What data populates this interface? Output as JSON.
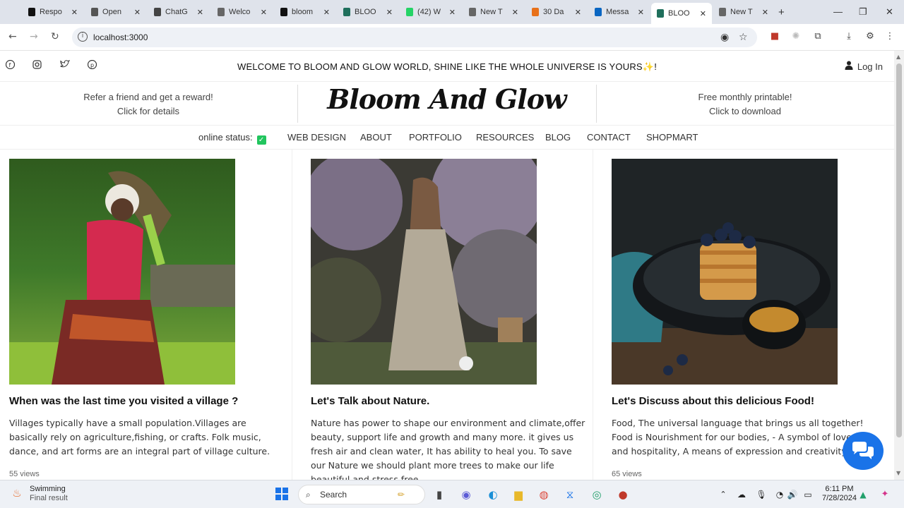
{
  "browser": {
    "tabs": [
      {
        "label": "Respo",
        "favicon_color": "#111111"
      },
      {
        "label": "Open",
        "favicon_color": "#555555"
      },
      {
        "label": "ChatG",
        "favicon_color": "#444444"
      },
      {
        "label": "Welco",
        "favicon_color": "#666666"
      },
      {
        "label": "bloom",
        "favicon_color": "#111111"
      },
      {
        "label": "BLOO",
        "favicon_color": "#1f6f5c"
      },
      {
        "label": "(42) W",
        "favicon_color": "#25d366"
      },
      {
        "label": "New T",
        "favicon_color": "#666666"
      },
      {
        "label": "30 Da",
        "favicon_color": "#e8711a"
      },
      {
        "label": "Messa",
        "favicon_color": "#0a66c2"
      },
      {
        "label": "BLOO",
        "favicon_color": "#1f6f5c",
        "active": true
      },
      {
        "label": "New T",
        "favicon_color": "#666666"
      }
    ],
    "url": "localhost:3000"
  },
  "site": {
    "welcome": "WELCOME TO BLOOM AND GLOW WORLD, SHINE LIKE THE WHOLE UNIVERSE IS YOURS",
    "welcome_emoji": "✨",
    "welcome_end": "!",
    "login_label": "Log In",
    "promo_left": {
      "line1": "Refer a friend and get a reward!",
      "line2": "Click for details"
    },
    "logo": "Bloom And Glow",
    "promo_right": {
      "line1": "Free monthly printable!",
      "line2": "Click to download"
    },
    "nav": {
      "status_label": "online status:",
      "items": [
        "WEB DESIGN",
        "ABOUT",
        "PORTFOLIO",
        "RESOURCES",
        "BLOG",
        "CONTACT",
        "SHOPMART"
      ]
    },
    "cards": [
      {
        "title": "When was the last time you visited a village ?",
        "text": "Villages typically have a small population.Villages are basically rely on agriculture,fishing, or crafts. Folk music, dance, and art forms are an integral part of village culture.",
        "views": "55 views"
      },
      {
        "title": "Let's Talk about Nature.",
        "text": "Nature has power to shape our environment and climate,offer beauty, support life and growth and many more. it gives us fresh air and clean water, It has ability to heal you. To save our Nature we should plant more trees to make our life beautiful and stress free.",
        "views": ""
      },
      {
        "title": "Let's Discuss about this delicious Food!",
        "text": "Food, The universal language that brings us all together! Food is Nourishment for our bodies, - A symbol of love, care, and hospitality, A means of expression and creativity.",
        "views": "65 views"
      }
    ]
  },
  "taskbar": {
    "weather_title": "Swimming",
    "weather_sub": "Final result",
    "search_label": "Search",
    "time": "6:11 PM",
    "date": "7/28/2024"
  },
  "colors": {
    "accent": "#1a73e8",
    "status_green": "#22c55e"
  }
}
